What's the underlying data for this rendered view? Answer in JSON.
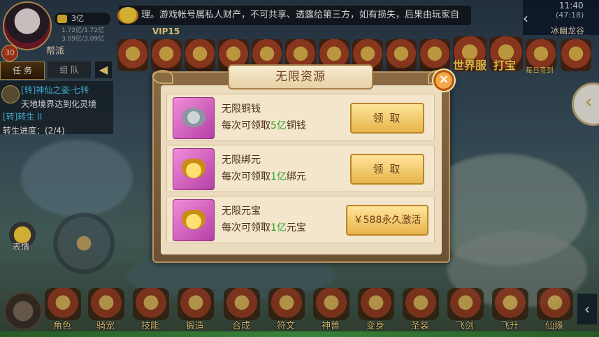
{
  "hud": {
    "gold_amount": "3亿",
    "level": "30",
    "faction": "帮派",
    "vip": "VIP15",
    "stat_1": "1.72亿/1.72亿",
    "stat_2": "3.09亿/3.09亿",
    "marquee": "理。游戏帐号属私人财产，不可共享、透露给第三方，如有损失，后果由玩家自",
    "clock": "11:40",
    "clock_sub": "(47:18)",
    "location": "冰幽龙谷",
    "tag_world": "世界服",
    "tag_treasure": "打宝",
    "tag_sign": "每日签到"
  },
  "quest": {
    "tab_task": "任 务",
    "tab_team": "组 队",
    "toggle": "◀",
    "line1": "[转]神仙之姿·七转",
    "line2": "天地境界达到化灵境",
    "line3": "[转]转生 II",
    "line4": "转生进度：(2/4)"
  },
  "left_controls": {
    "emote_label": "表情"
  },
  "bottom_menu": [
    {
      "label": "角色"
    },
    {
      "label": "骑宠"
    },
    {
      "label": "技能"
    },
    {
      "label": "锻造"
    },
    {
      "label": "合成"
    },
    {
      "label": "符文"
    },
    {
      "label": "神兽"
    },
    {
      "label": "变身"
    },
    {
      "label": "圣装"
    },
    {
      "label": "飞剑"
    },
    {
      "label": "飞升"
    },
    {
      "label": "仙缘"
    }
  ],
  "modal": {
    "title": "无限资源",
    "close": "×",
    "rows": [
      {
        "name": "无限铜钱",
        "desc_pre": "每次可领取",
        "desc_hl": "5亿",
        "desc_post": "铜钱",
        "button": "领 取",
        "icon": "silver-coins-icon"
      },
      {
        "name": "无限绑元",
        "desc_pre": "每次可领取",
        "desc_hl": "1亿",
        "desc_post": "绑元",
        "button": "领 取",
        "icon": "bound-gold-ingot-icon"
      },
      {
        "name": "无限元宝",
        "desc_pre": "每次可领取",
        "desc_hl": "1亿",
        "desc_post": "元宝",
        "button": "￥588永久激活",
        "icon": "gold-ingot-icon"
      }
    ]
  },
  "colors": {
    "highlight_green": "#2fa12f",
    "button_gold": "#e7b44a",
    "panel_brown": "#6d5134"
  }
}
